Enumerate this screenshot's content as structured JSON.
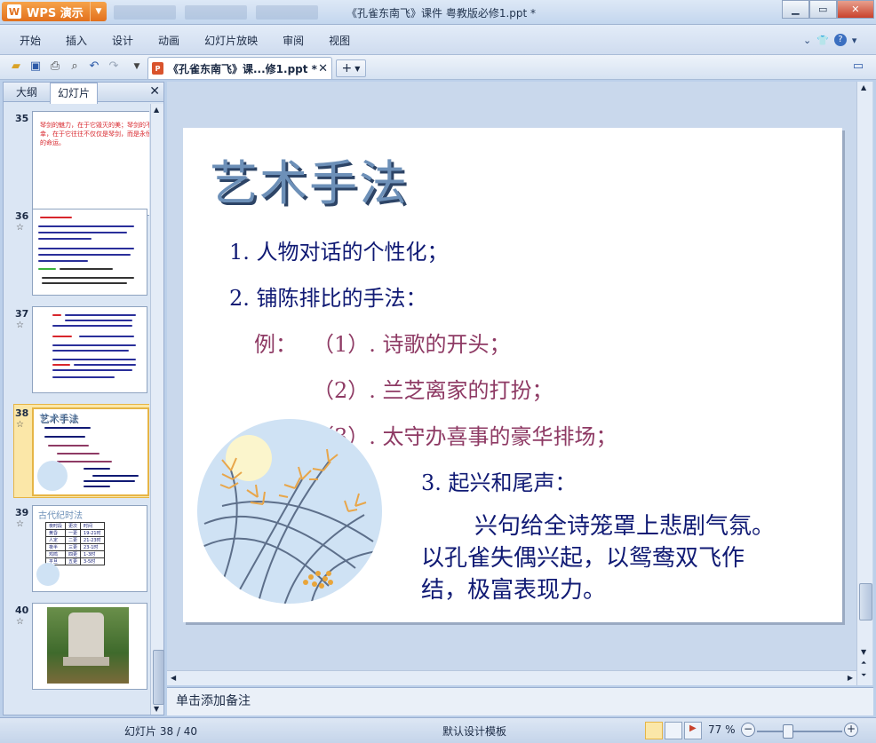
{
  "window": {
    "app_name": "WPS 演示",
    "title": "《孔雀东南飞》课件 粤教版必修1.ppt *",
    "minimize": "▁",
    "restore": "▭",
    "close": "✕"
  },
  "menu": {
    "items": [
      "开始",
      "插入",
      "设计",
      "动画",
      "幻灯片放映",
      "审阅",
      "视图"
    ]
  },
  "toolbar": {
    "icons": [
      "open-icon",
      "save-icon",
      "print-icon",
      "print-preview-icon",
      "undo-icon",
      "redo-icon"
    ],
    "doc_tab_label": "《孔雀东南飞》课...修1.ppt *",
    "doc_tab_close": "✕",
    "new_tab": "+"
  },
  "left_panel": {
    "tab_outline": "大纲",
    "tab_slides": "幻灯片",
    "close": "✕",
    "slides": [
      {
        "number": "35",
        "starred": false
      },
      {
        "number": "36",
        "starred": true
      },
      {
        "number": "37",
        "starred": true
      },
      {
        "number": "38",
        "starred": true,
        "selected": true
      },
      {
        "number": "39",
        "starred": true
      },
      {
        "number": "40",
        "starred": true
      }
    ],
    "thumb_texts": {
      "s35": "琴剑的魅力，在于它毁灭的美；琴剑的不幸，在于它往往不仅仅是琴剑，而是永恒的命运。",
      "s38_title": "艺术手法",
      "s39_title": "古代纪时法",
      "s39_rows": [
        [
          "夜时段",
          "更次",
          "时间"
        ],
        [
          "黄昏",
          "一更",
          "19-21时"
        ],
        [
          "人定",
          "二更",
          "21-23时"
        ],
        [
          "夜半",
          "三更",
          "23-1时"
        ],
        [
          "鸡鸣",
          "四更",
          "1-3时"
        ],
        [
          "平旦",
          "五更",
          "3-5时"
        ]
      ]
    }
  },
  "slide": {
    "title": "艺术手法",
    "line1": "1. 人物对话的个性化；",
    "line2": "2. 铺陈排比的手法：",
    "example_label": "例：",
    "ex1": "（1）. 诗歌的开头；",
    "ex2": "（2）. 兰芝离家的打扮；",
    "ex3": "（3）. 太守办喜事的豪华排场；",
    "line3": "3. 起兴和尾声：",
    "para1": "兴句给全诗笼罩上悲剧气氛。",
    "para2": "以孔雀失偶兴起，以鸳鸯双飞作",
    "para3": "结，极富表现力。"
  },
  "notes": {
    "placeholder": "单击添加备注"
  },
  "status": {
    "slide_counter": "幻灯片 38 / 40",
    "template": "默认设计模板",
    "zoom": "77 %",
    "zoom_minus": "−",
    "zoom_plus": "+"
  },
  "colors": {
    "slide_navy": "#101a74",
    "slide_maroon": "#8e3a64",
    "title_blue": "#6d90b8",
    "wps_orange": "#e2701d"
  }
}
